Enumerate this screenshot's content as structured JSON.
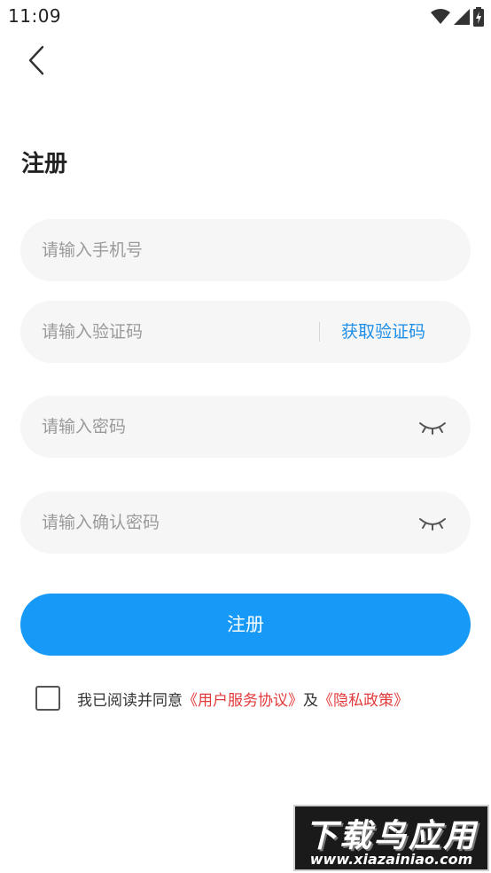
{
  "status_bar": {
    "time": "11:09",
    "icons": [
      "wifi-icon",
      "signal-icon",
      "battery-charging-icon"
    ]
  },
  "header": {
    "back_icon": "chevron-left-icon",
    "title": "注册"
  },
  "form": {
    "phone": {
      "placeholder": "请输入手机号",
      "value": ""
    },
    "code": {
      "placeholder": "请输入验证码",
      "value": "",
      "get_code_label": "获取验证码"
    },
    "password": {
      "placeholder": "请输入密码",
      "value": "",
      "toggle_icon": "eye-closed-icon"
    },
    "confirm_password": {
      "placeholder": "请输入确认密码",
      "value": "",
      "toggle_icon": "eye-closed-icon"
    },
    "submit_label": "注册"
  },
  "agreement": {
    "checked": false,
    "prefix": "我已阅读并同意",
    "terms_link": "《用户服务协议》",
    "conjunction": "及",
    "privacy_link": "《隐私政策》"
  },
  "watermark": {
    "title": "下载鸟应用",
    "url": "www.xiazainiao.com"
  },
  "colors": {
    "accent": "#1799f7",
    "link_blue": "#1e8fe8",
    "link_red": "#e23a3a",
    "field_bg": "#f6f6f6"
  }
}
